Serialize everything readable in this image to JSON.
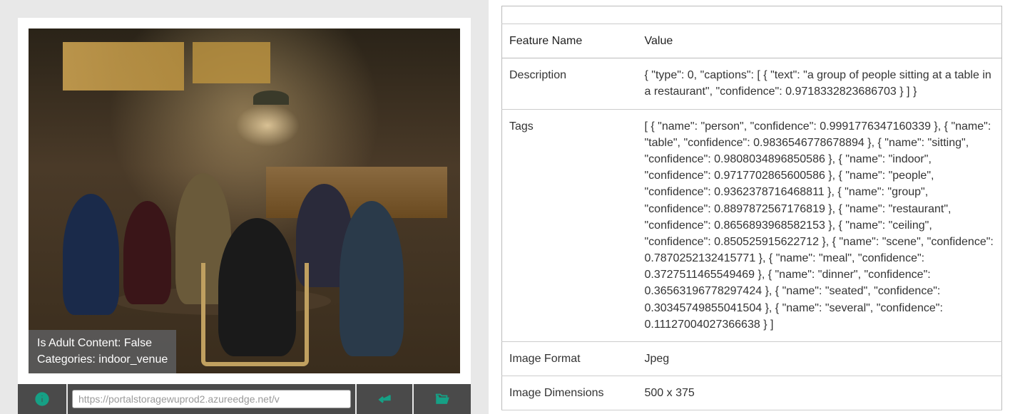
{
  "overlay": {
    "line1": "Is Adult Content: False",
    "line2": "Categories: indoor_venue"
  },
  "toolbar": {
    "url_value": "https://portalstoragewuprod2.azureedge.net/v"
  },
  "table": {
    "header_name": "Feature Name",
    "header_value": "Value",
    "rows": [
      {
        "name": "Description",
        "value": "{ \"type\": 0, \"captions\": [ { \"text\": \"a group of people sitting at a table in a restaurant\", \"confidence\": 0.9718332823686703 } ] }"
      },
      {
        "name": "Tags",
        "value": "[ { \"name\": \"person\", \"confidence\": 0.9991776347160339 }, { \"name\": \"table\", \"confidence\": 0.9836546778678894 }, { \"name\": \"sitting\", \"confidence\": 0.9808034896850586 }, { \"name\": \"indoor\", \"confidence\": 0.9717702865600586 }, { \"name\": \"people\", \"confidence\": 0.9362378716468811 }, { \"name\": \"group\", \"confidence\": 0.8897872567176819 }, { \"name\": \"restaurant\", \"confidence\": 0.8656893968582153 }, { \"name\": \"ceiling\", \"confidence\": 0.850525915622712 }, { \"name\": \"scene\", \"confidence\": 0.7870252132415771 }, { \"name\": \"meal\", \"confidence\": 0.3727511465549469 }, { \"name\": \"dinner\", \"confidence\": 0.36563196778297424 }, { \"name\": \"seated\", \"confidence\": 0.30345749855041504 }, { \"name\": \"several\", \"confidence\": 0.11127004027366638 } ]"
      },
      {
        "name": "Image Format",
        "value": "Jpeg"
      },
      {
        "name": "Image Dimensions",
        "value": "500 x 375"
      }
    ]
  }
}
